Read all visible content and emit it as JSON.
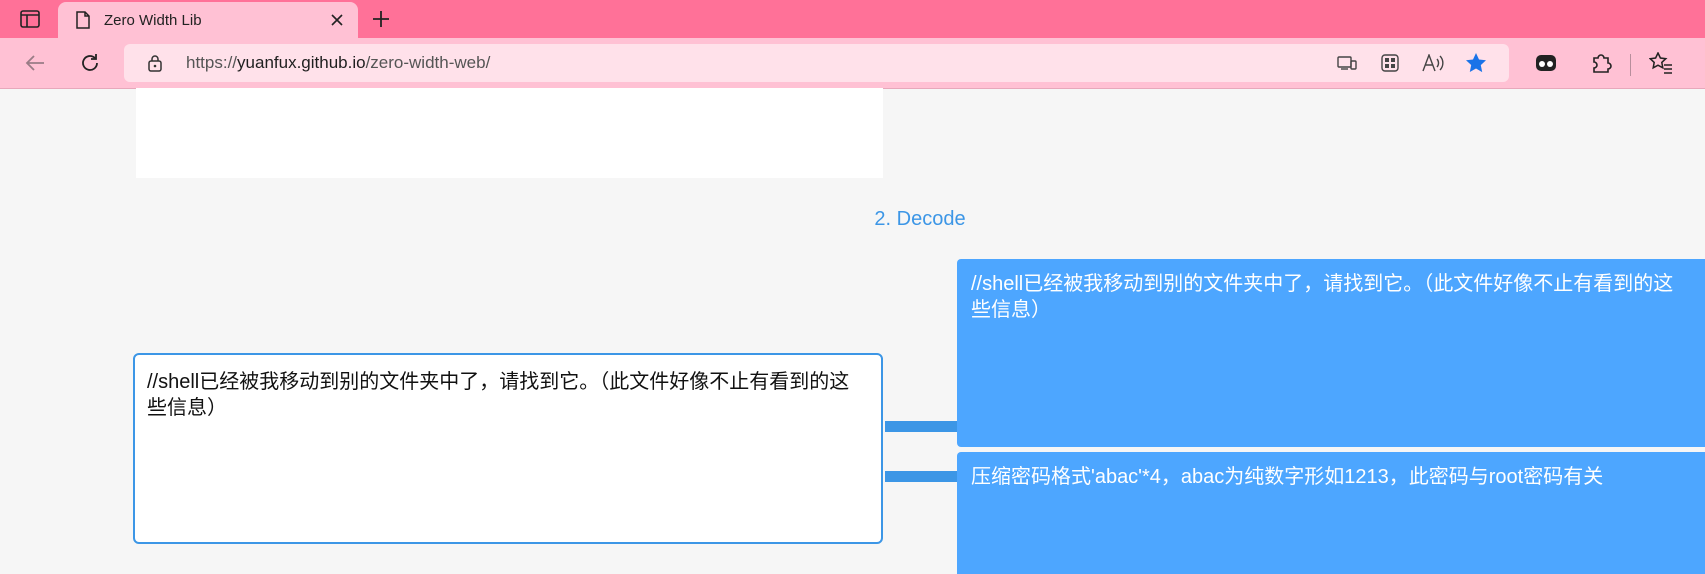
{
  "browser": {
    "tab": {
      "title": "Zero Width Lib"
    },
    "address": {
      "scheme": "https://",
      "host": "yuanfux.github.io",
      "path": "/zero-width-web/"
    }
  },
  "page": {
    "section_title": "2. Decode",
    "input_text": "//shell已经被我移动到别的文件夹中了，请找到它。（此文件好像不止有看到的这些信息）",
    "outputs": [
      "//shell已经被我移动到别的文件夹中了，请找到它。（此文件好像不止有看到的这些信息）",
      "压缩密码格式'abac'*4，abac为纯数字形如1213，此密码与root密码有关"
    ]
  },
  "icons": {
    "tab_actions": "tab-actions-icon",
    "tab_page": "page-icon",
    "tab_close": "close-icon",
    "new_tab": "plus-icon",
    "back": "back-arrow-icon",
    "refresh": "refresh-icon",
    "lock": "lock-icon",
    "devices": "devices-icon",
    "apps": "apps-icon",
    "read_aloud": "read-aloud-icon",
    "favorite": "star-icon",
    "profile": "profile-icon",
    "extensions": "puzzle-icon",
    "favorites_list": "favorites-icon"
  },
  "colors": {
    "tabbar": "#ff7198",
    "toolbar": "#ffc1d4",
    "accent": "#3c96e6",
    "output_bg": "#4da6ff",
    "star": "#1a73e8"
  }
}
